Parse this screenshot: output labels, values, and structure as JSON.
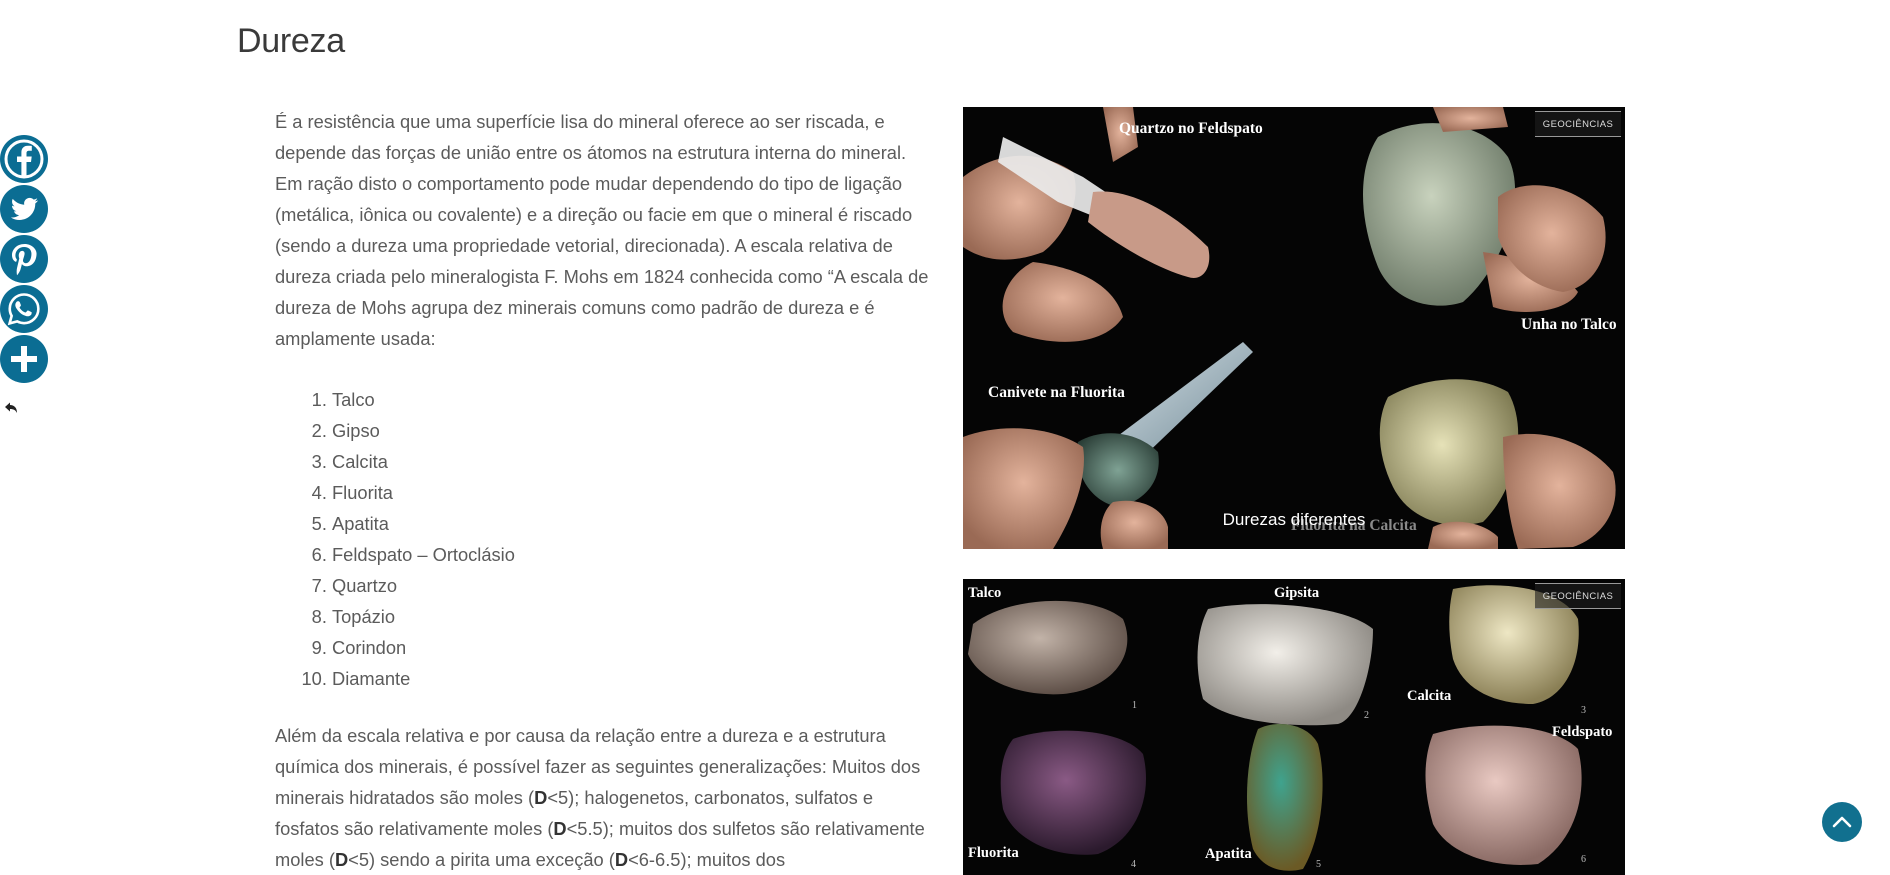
{
  "section": {
    "title": "Dureza"
  },
  "intro_text": "É a resistência que uma superfície lisa do mineral oferece ao ser riscada, e depende das forças de união entre os átomos na estrutura interna do mineral. Em ração disto o comportamento pode mudar dependendo do tipo de ligação (metálica, iônica ou covalente) e a direção ou facie em que o mineral é riscado (sendo a dureza uma propriedade vetorial, direcionada). A escala relativa de dureza criada pelo mineralogista F. Mohs em 1824 conhecida como “A escala de dureza de Mohs agrupa dez minerais comuns como padrão de dureza e é amplamente usada:",
  "hardness_scale": [
    "Talco",
    "Gipso",
    "Calcita",
    "Fluorita",
    "Apatita",
    "Feldspato – Ortoclásio",
    "Quartzo",
    "Topázio",
    "Corindon",
    "Diamante"
  ],
  "outro": {
    "part1": "Além da escala relativa e por causa da relação entre a dureza e a estrutura química dos minerais, é possível fazer as seguintes generalizações: Muitos dos minerais hidratados são moles (",
    "d1": "D",
    "part2": "<5); halogenetos, carbonatos, sulfatos e fosfatos são relativamente moles (",
    "d2": "D",
    "part3": "<5.5); muitos dos sulfetos são relativamente moles (",
    "d3": "D",
    "part4": "<5) sendo a pirita uma exceção (",
    "d4": "D",
    "part5": "<6-6.5); muitos dos"
  },
  "photo1": {
    "labels": {
      "quartz": "Quartzo no Feldspato",
      "nail": "Unha no Talco",
      "knife": "Canivete na Fluorita",
      "calcite": "Fluorita na Calcita"
    },
    "caption": "Durezas diferentes",
    "watermark": "GEOCIÊNCIAS"
  },
  "photo2": {
    "minerals": [
      {
        "name": "Talco",
        "num": "1"
      },
      {
        "name": "Gipsita",
        "num": "2"
      },
      {
        "name": "Calcita",
        "num": "3"
      },
      {
        "name": "Fluorita",
        "num": "4"
      },
      {
        "name": "Apatita",
        "num": "5"
      },
      {
        "name": "Feldspato",
        "num": "6"
      }
    ],
    "watermark": "GEOCIÊNCIAS"
  },
  "share": {
    "buttons": [
      "facebook-icon",
      "twitter-icon",
      "pinterest-icon",
      "whatsapp-icon",
      "plus-icon"
    ],
    "color": "#0b6d93"
  },
  "colors": {
    "accent": "#0b6d93",
    "text": "#5b5b5b",
    "heading": "#3a3a3a"
  }
}
